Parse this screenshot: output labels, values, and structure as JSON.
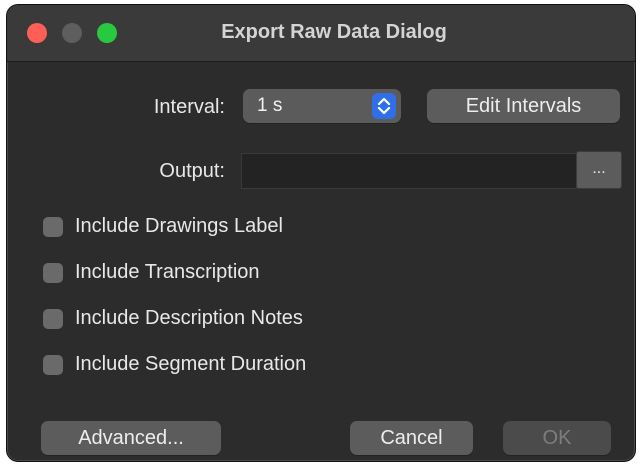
{
  "window": {
    "title": "Export Raw Data Dialog"
  },
  "interval": {
    "label": "Interval:",
    "value": "1 s",
    "edit_button": "Edit Intervals"
  },
  "output": {
    "label": "Output:",
    "value": "",
    "browse_button": "..."
  },
  "options": [
    {
      "label": "Include Drawings Label",
      "checked": false
    },
    {
      "label": "Include Transcription",
      "checked": false
    },
    {
      "label": "Include Description Notes",
      "checked": false
    },
    {
      "label": "Include Segment Duration",
      "checked": false
    }
  ],
  "footer": {
    "advanced_button": "Advanced...",
    "cancel_button": "Cancel",
    "ok_button": "OK",
    "ok_enabled": false
  },
  "colors": {
    "close": "#fe5f57",
    "minimize": "#5e5e5e",
    "maximize": "#28c840",
    "accent": "#2f6fe8"
  },
  "icons": {
    "stepper": "up-down-chevron-icon"
  }
}
